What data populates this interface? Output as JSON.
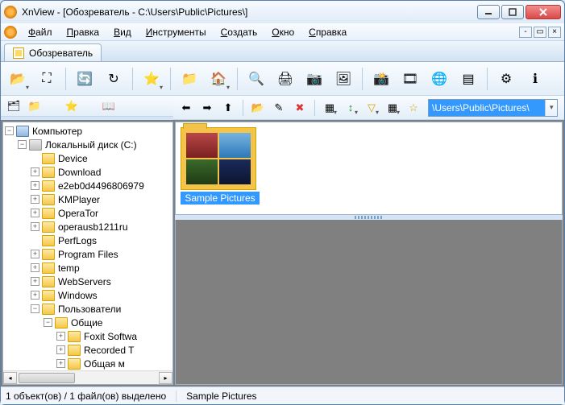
{
  "window": {
    "title": "XnView - [Обозреватель - C:\\Users\\Public\\Pictures\\]"
  },
  "menu": {
    "items": [
      "Файл",
      "Правка",
      "Вид",
      "Инструменты",
      "Создать",
      "Окно",
      "Справка"
    ]
  },
  "tab": {
    "label": "Обозреватель"
  },
  "path_field": {
    "value": "\\Users\\Public\\Pictures\\"
  },
  "tree": {
    "root": "Компьютер",
    "drive": "Локальный диск (C:)",
    "folders": [
      {
        "name": "Device",
        "exp": "none"
      },
      {
        "name": "Download",
        "exp": "plus"
      },
      {
        "name": "e2eb0d4496806979",
        "exp": "plus"
      },
      {
        "name": "KMPlayer",
        "exp": "plus"
      },
      {
        "name": "OperaTor",
        "exp": "plus"
      },
      {
        "name": "operausb1211ru",
        "exp": "plus"
      },
      {
        "name": "PerfLogs",
        "exp": "none"
      },
      {
        "name": "Program Files",
        "exp": "plus"
      },
      {
        "name": "temp",
        "exp": "plus"
      },
      {
        "name": "WebServers",
        "exp": "plus"
      },
      {
        "name": "Windows",
        "exp": "plus"
      }
    ],
    "users": "Пользователи",
    "public": "Общие",
    "public_children": [
      {
        "name": "Foxit Softwa",
        "exp": "plus"
      },
      {
        "name": "Recorded T",
        "exp": "plus"
      },
      {
        "name": "Общая м",
        "exp": "plus"
      }
    ]
  },
  "thumb": {
    "label": "Sample Pictures"
  },
  "status": {
    "left": "1 объект(ов) / 1 файл(ов) выделено",
    "right": "Sample Pictures"
  },
  "icons": {
    "open": "📂",
    "fullscreen": "⛶",
    "refresh": "🔄",
    "rotate": "↻",
    "favorite": "⭐",
    "explorer": "📁",
    "up": "⬆",
    "home": "🏠",
    "binoculars": "🔍",
    "print": "🖨",
    "scanner": "📷",
    "convert": "🖼",
    "camera": "📸",
    "slideshow": "🎞",
    "web": "🌐",
    "settings": "⚙",
    "info": "ℹ",
    "back": "⬅",
    "forward": "➡",
    "newfolder": "📂",
    "rename": "✎",
    "delete": "✖",
    "view": "▦",
    "sort": "↕",
    "filter": "▽",
    "star": "☆",
    "cat": "🗂",
    "fav": "⭐",
    "book": "📖"
  }
}
